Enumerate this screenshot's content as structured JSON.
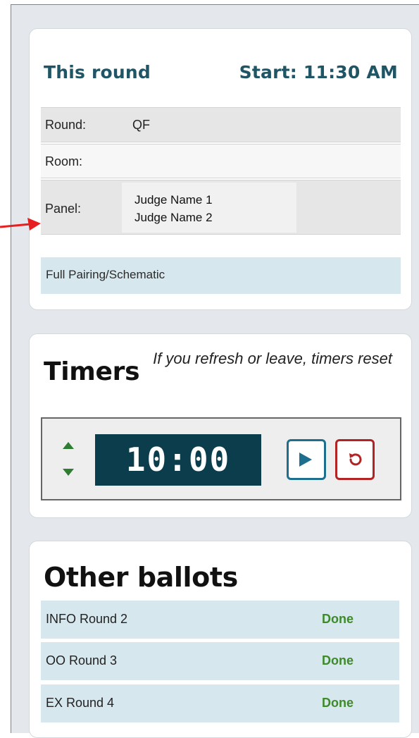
{
  "round_card": {
    "title": "This round",
    "start": "Start: 11:30 AM",
    "rows": {
      "round_label": "Round:",
      "round_value": "QF",
      "room_label": "Room:",
      "room_value": "",
      "panel_label": "Panel:",
      "judges": [
        "Judge Name 1",
        "Judge Name 2"
      ]
    },
    "schematic_link": "Full Pairing/Schematic"
  },
  "timers_card": {
    "title": "Timers",
    "note": "If you refresh or leave, timers reset",
    "time": "10:00"
  },
  "ballots_card": {
    "title": "Other ballots",
    "items": [
      {
        "name": "INFO Round 2",
        "status": "Done"
      },
      {
        "name": "OO Round 3",
        "status": "Done"
      },
      {
        "name": "EX Round 4",
        "status": "Done"
      }
    ]
  },
  "colors": {
    "accent": "#1f5565",
    "timer_bg": "#0c3d4d",
    "play": "#1d6f8d",
    "reset": "#b22424",
    "done": "#3e8a2b",
    "pointer": "#e62020"
  },
  "icons": {
    "pointer": "red-arrow-icon",
    "up": "chevron-up-icon",
    "down": "chevron-down-icon",
    "play": "play-icon",
    "reset": "reset-icon"
  }
}
